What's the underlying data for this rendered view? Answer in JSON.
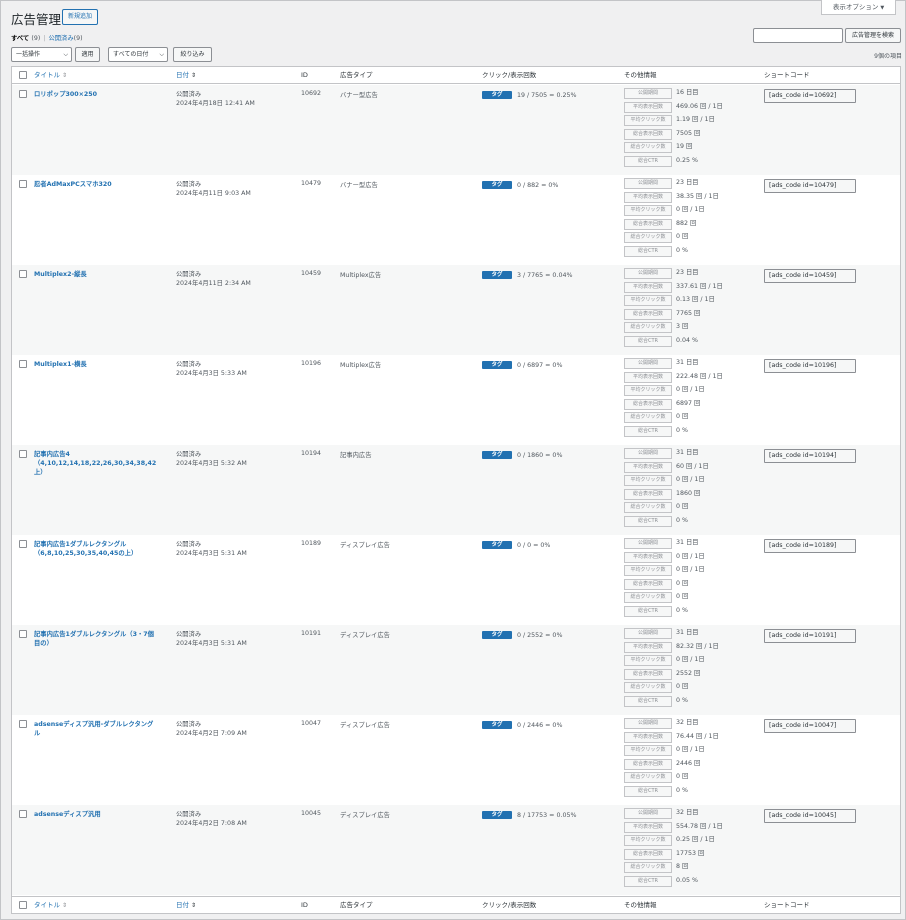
{
  "header": {
    "screen_options": "表示オプション",
    "title": "広告管理",
    "add_new": "新規追加"
  },
  "views": {
    "all_label": "すべて",
    "all_count": "(9)",
    "published_label": "公開済み",
    "published_count": "(9)"
  },
  "search": {
    "button": "広告管理を検索",
    "value": ""
  },
  "filters": {
    "bulk_action": "一括操作",
    "apply": "適用",
    "all_dates": "すべての日付",
    "filter": "絞り込み"
  },
  "items_count": "9個の項目",
  "columns": {
    "title": "タイトル",
    "date": "日付",
    "id": "ID",
    "type": "広告タイプ",
    "click": "クリック/表示回数",
    "info": "その他情報",
    "shortcode": "ショートコード"
  },
  "tag_label": "タグ",
  "info_labels": [
    "公開期間",
    "平均表示回数",
    "平均クリック数",
    "総合表示回数",
    "総合クリック数",
    "総合CTR"
  ],
  "rows": [
    {
      "title": "ロリポップ300×250",
      "status": "公開済み",
      "date": "2024年4月18日 12:41 AM",
      "id": "10692",
      "type": "バナー型広告",
      "click": "19 / 7505 = 0.25%",
      "info": [
        "16 日目",
        "469.06 回 / 1日",
        "1.19 回 / 1日",
        "7505 回",
        "19 回",
        "0.25 %"
      ],
      "shortcode": "[ads_code id=10692]"
    },
    {
      "title": "忍者AdMaxPCスマホ320",
      "status": "公開済み",
      "date": "2024年4月11日 9:03 AM",
      "id": "10479",
      "type": "バナー型広告",
      "click": "0 / 882 = 0%",
      "info": [
        "23 日目",
        "38.35 回 / 1日",
        "0 回 / 1日",
        "882 回",
        "0 回",
        "0 %"
      ],
      "shortcode": "[ads_code id=10479]"
    },
    {
      "title": "Multiplex2-縦長",
      "status": "公開済み",
      "date": "2024年4月11日 2:34 AM",
      "id": "10459",
      "type": "Multiplex広告",
      "click": "3 / 7765 = 0.04%",
      "info": [
        "23 日目",
        "337.61 回 / 1日",
        "0.13 回 / 1日",
        "7765 回",
        "3 回",
        "0.04 %"
      ],
      "shortcode": "[ads_code id=10459]"
    },
    {
      "title": "Multiplex1-横長",
      "status": "公開済み",
      "date": "2024年4月3日 5:33 AM",
      "id": "10196",
      "type": "Multiplex広告",
      "click": "0 / 6897 = 0%",
      "info": [
        "31 日目",
        "222.48 回 / 1日",
        "0 回 / 1日",
        "6897 回",
        "0 回",
        "0 %"
      ],
      "shortcode": "[ads_code id=10196]"
    },
    {
      "title": "記事内広告4（4,10,12,14,18,22,26,30,34,38,42上）",
      "status": "公開済み",
      "date": "2024年4月3日 5:32 AM",
      "id": "10194",
      "type": "記事内広告",
      "click": "0 / 1860 = 0%",
      "info": [
        "31 日目",
        "60 回 / 1日",
        "0 回 / 1日",
        "1860 回",
        "0 回",
        "0 %"
      ],
      "shortcode": "[ads_code id=10194]"
    },
    {
      "title": "記事内広告1ダブルレクタングル（6,8,10,25,30,35,40,45の上）",
      "status": "公開済み",
      "date": "2024年4月3日 5:31 AM",
      "id": "10189",
      "type": "ディスプレイ広告",
      "click": "0 / 0 = 0%",
      "info": [
        "31 日目",
        "0 回 / 1日",
        "0 回 / 1日",
        "0 回",
        "0 回",
        "0 %"
      ],
      "shortcode": "[ads_code id=10189]"
    },
    {
      "title": "記事内広告1ダブルレクタングル（3・7個目の）",
      "status": "公開済み",
      "date": "2024年4月3日 5:31 AM",
      "id": "10191",
      "type": "ディスプレイ広告",
      "click": "0 / 2552 = 0%",
      "info": [
        "31 日目",
        "82.32 回 / 1日",
        "0 回 / 1日",
        "2552 回",
        "0 回",
        "0 %"
      ],
      "shortcode": "[ads_code id=10191]"
    },
    {
      "title": "adsenseディスプ汎用-ダブルレクタングル",
      "status": "公開済み",
      "date": "2024年4月2日 7:09 AM",
      "id": "10047",
      "type": "ディスプレイ広告",
      "click": "0 / 2446 = 0%",
      "info": [
        "32 日目",
        "76.44 回 / 1日",
        "0 回 / 1日",
        "2446 回",
        "0 回",
        "0 %"
      ],
      "shortcode": "[ads_code id=10047]"
    },
    {
      "title": "adsenseディスプ汎用",
      "status": "公開済み",
      "date": "2024年4月2日 7:08 AM",
      "id": "10045",
      "type": "ディスプレイ広告",
      "click": "8 / 17753 = 0.05%",
      "info": [
        "32 日目",
        "554.78 回 / 1日",
        "0.25 回 / 1日",
        "17753 回",
        "8 回",
        "0.05 %"
      ],
      "shortcode": "[ads_code id=10045]"
    }
  ]
}
